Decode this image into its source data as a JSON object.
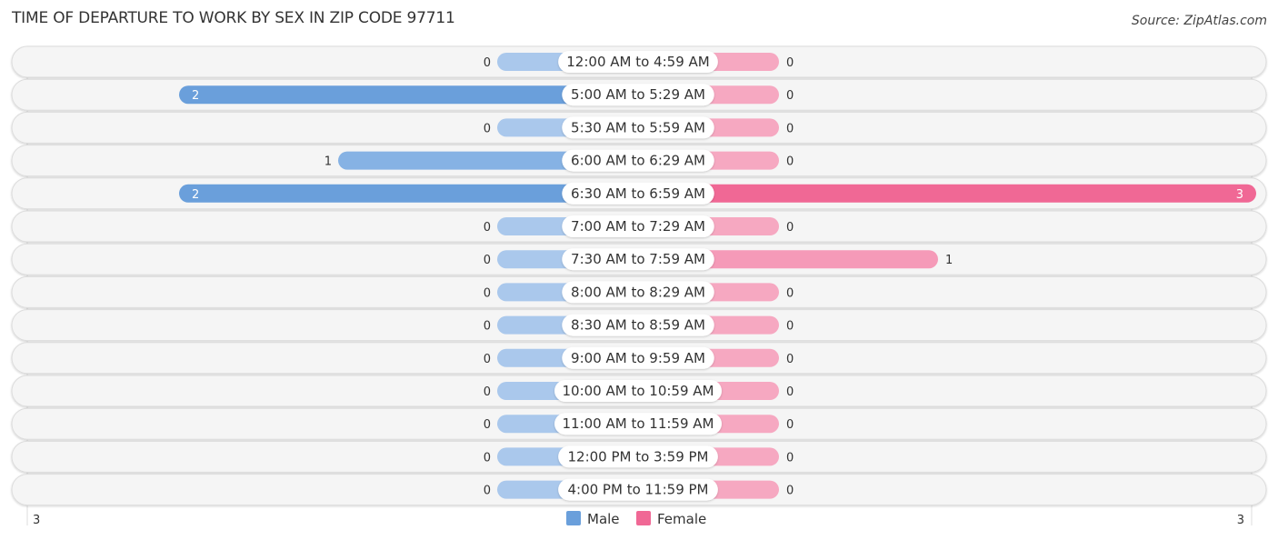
{
  "title": "TIME OF DEPARTURE TO WORK BY SEX IN ZIP CODE 97711",
  "source": "Source: ZipAtlas.com",
  "colors": {
    "male": "#6a9fdb",
    "male_light": "#aac8ec",
    "female": "#f06895",
    "female_light": "#f6a8c1"
  },
  "chart_data": {
    "type": "bar",
    "orientation": "horizontal-diverging",
    "title": "TIME OF DEPARTURE TO WORK BY SEX IN ZIP CODE 97711",
    "categories": [
      "12:00 AM to 4:59 AM",
      "5:00 AM to 5:29 AM",
      "5:30 AM to 5:59 AM",
      "6:00 AM to 6:29 AM",
      "6:30 AM to 6:59 AM",
      "7:00 AM to 7:29 AM",
      "7:30 AM to 7:59 AM",
      "8:00 AM to 8:29 AM",
      "8:30 AM to 8:59 AM",
      "9:00 AM to 9:59 AM",
      "10:00 AM to 10:59 AM",
      "11:00 AM to 11:59 AM",
      "12:00 PM to 3:59 PM",
      "4:00 PM to 11:59 PM"
    ],
    "series": [
      {
        "name": "Male",
        "values": [
          0,
          2,
          0,
          1,
          2,
          0,
          0,
          0,
          0,
          0,
          0,
          0,
          0,
          0
        ]
      },
      {
        "name": "Female",
        "values": [
          0,
          0,
          0,
          0,
          3,
          0,
          1,
          0,
          0,
          0,
          0,
          0,
          0,
          0
        ]
      }
    ],
    "xlim": [
      -3,
      3
    ],
    "axis_labels": {
      "left": "3",
      "right": "3"
    },
    "legend": {
      "position": "bottom-center",
      "items": [
        "Male",
        "Female"
      ]
    }
  }
}
